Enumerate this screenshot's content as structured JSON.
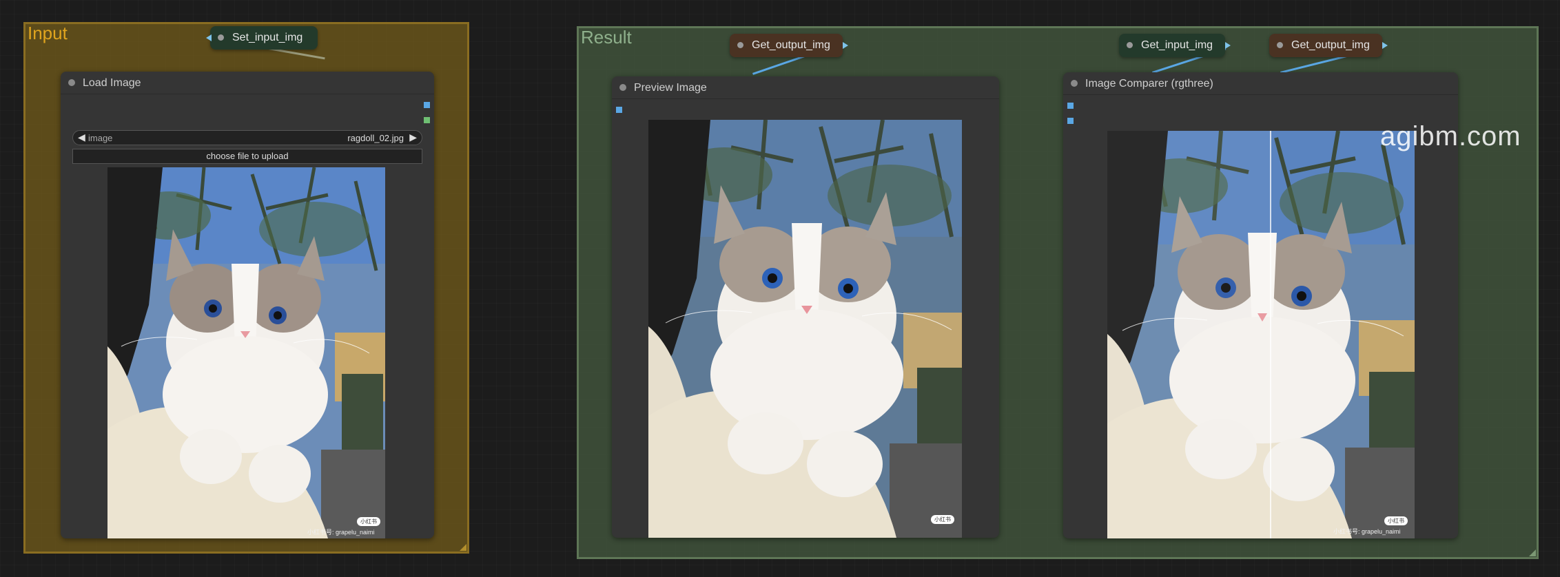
{
  "groups": {
    "input": {
      "title": "Input"
    },
    "result": {
      "title": "Result"
    }
  },
  "pills": {
    "set_input": "Set_input_img",
    "get_output_1": "Get_output_img",
    "get_input": "Get_input_img",
    "get_output_2": "Get_output_img"
  },
  "nodes": {
    "load_image": {
      "title": "Load Image",
      "widget_name": "image",
      "widget_value": "ragdoll_02.jpg",
      "upload_label": "choose file to upload"
    },
    "preview_image": {
      "title": "Preview Image"
    },
    "comparer": {
      "title": "Image Comparer (rgthree)",
      "split_fraction": 0.53
    }
  },
  "photo": {
    "watermark_text": "小红书号: grapelu_naimi",
    "watermark_badge": "小红书"
  },
  "site_watermark": "agibm.com",
  "colors": {
    "input_group": "#6e581a",
    "result_group": "#3e503a",
    "node_bg": "#353535",
    "link_blue": "#5aa7e4"
  }
}
